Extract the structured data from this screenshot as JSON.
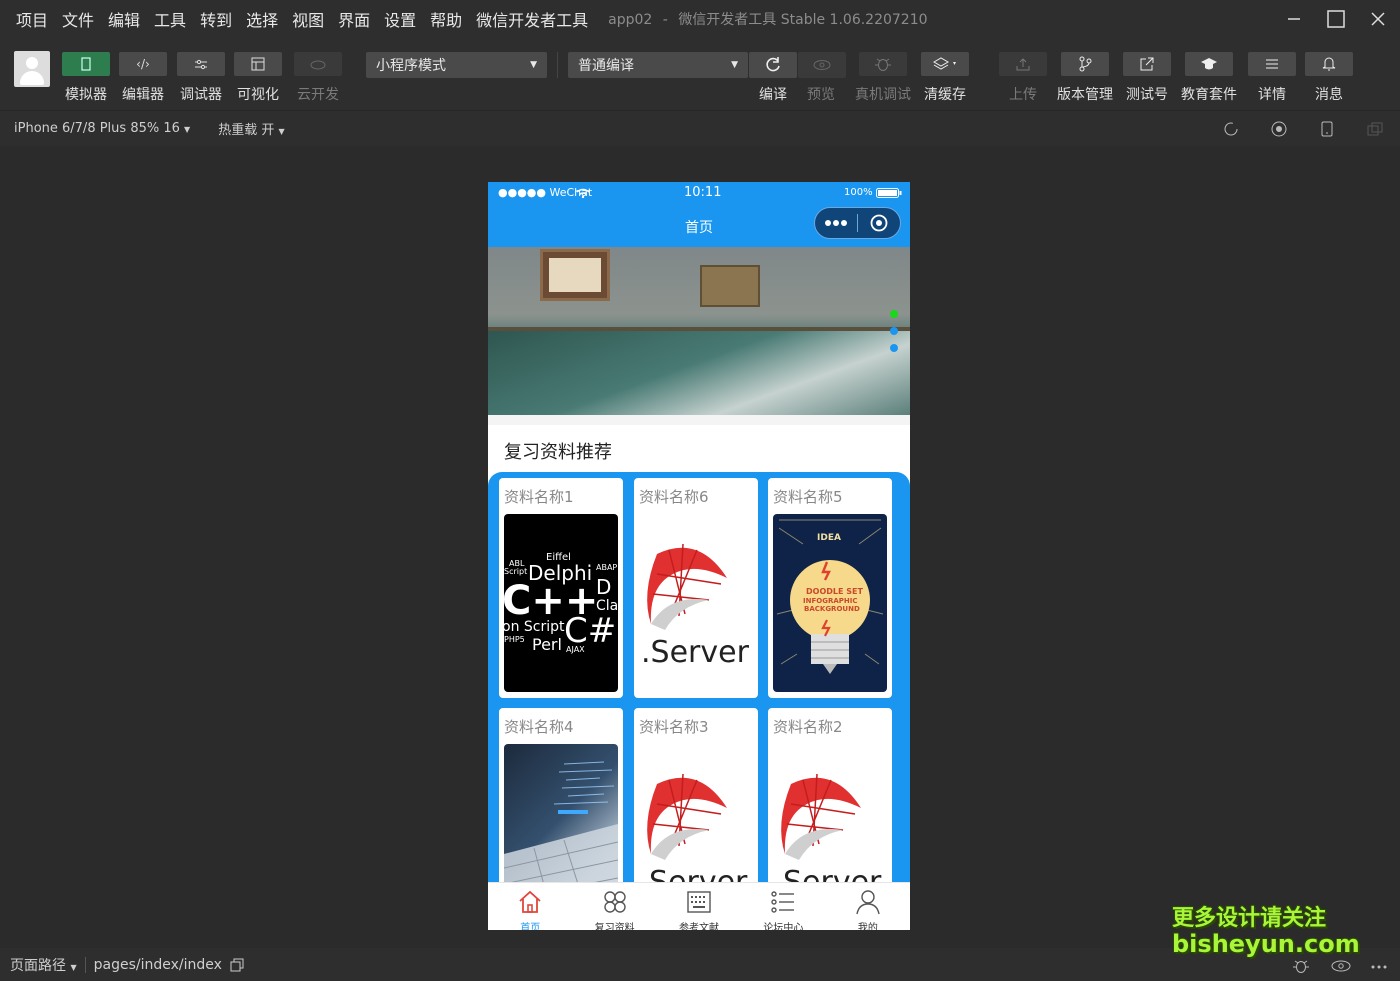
{
  "menubar": {
    "items": [
      "项目",
      "文件",
      "编辑",
      "工具",
      "转到",
      "选择",
      "视图",
      "界面",
      "设置",
      "帮助",
      "微信开发者工具"
    ],
    "app_name": "app02",
    "app_sep": "-",
    "app_version": "微信开发者工具 Stable 1.06.2207210"
  },
  "toolbar": {
    "simulator": "模拟器",
    "editor": "编辑器",
    "debugger": "调试器",
    "visual": "可视化",
    "cloud": "云开发",
    "mode_select": "小程序模式",
    "compile_select": "普通编译",
    "compile": "编译",
    "preview": "预览",
    "remote_debug": "真机调试",
    "clear_cache": "清缓存",
    "upload": "上传",
    "version": "版本管理",
    "test_account": "测试号",
    "edu": "教育套件",
    "details": "详情",
    "messages": "消息"
  },
  "subbar": {
    "device": "iPhone 6/7/8 Plus 85% 16",
    "hot_reload": "热重载 开"
  },
  "phone": {
    "carrier": "●●●●● WeChat",
    "time": "10:11",
    "battery": "100%",
    "nav_title": "首页",
    "section_title": "复习资料推荐",
    "cards": [
      {
        "title": "资料名称1"
      },
      {
        "title": "资料名称6"
      },
      {
        "title": "资料名称5"
      },
      {
        "title": "资料名称4"
      },
      {
        "title": "资料名称3"
      },
      {
        "title": "资料名称2"
      }
    ],
    "img_text": {
      "server": ".Server",
      "server_cut": "Server",
      "doodle": "DOODLE SET\nINFOGRAPHIC\nBACKGROUND",
      "idea": "IDEA"
    },
    "tabs": [
      "首页",
      "复习资料",
      "参考文献",
      "论坛中心",
      "我的"
    ]
  },
  "statusbar": {
    "path_label": "页面路径",
    "path": "pages/index/index"
  },
  "watermark": {
    "line1": "更多设计请关注",
    "line2": "bisheyun.com"
  },
  "colors": {
    "accent": "#1a96f0",
    "toolbar_active": "#2e7d4f",
    "watermark": "#a8f53a"
  }
}
